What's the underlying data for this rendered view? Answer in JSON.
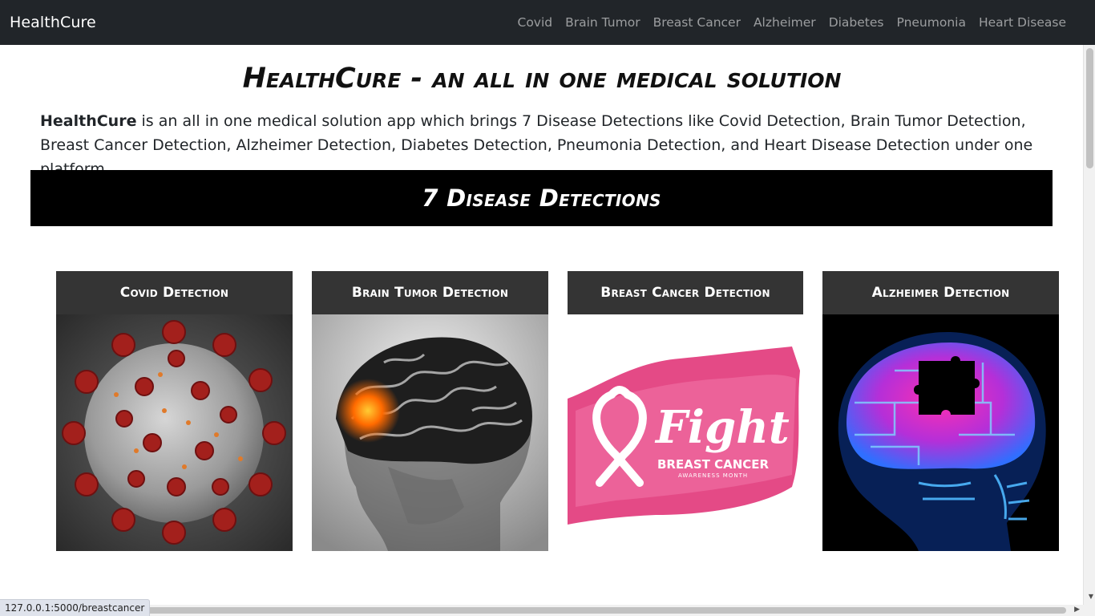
{
  "navbar": {
    "brand": "HealthCure",
    "links": [
      "Covid",
      "Brain Tumor",
      "Breast Cancer",
      "Alzheimer",
      "Diabetes",
      "Pneumonia",
      "Heart Disease"
    ]
  },
  "hero": {
    "title": "HealthCure - an all in one medical solution",
    "intro_brand": "HealthCure",
    "intro_text": " is an all in one medical solution app which brings 7 Disease Detections like Covid Detection, Brain Tumor Detection, Breast Cancer Detection, Alzheimer Detection, Diabetes Detection, Pneumonia Detection, and Heart Disease Detection under one platform."
  },
  "section": {
    "heading": "7 Disease Detections"
  },
  "cards": [
    {
      "title": "Covid Detection",
      "image": "coronavirus-illustration"
    },
    {
      "title": "Brain Tumor Detection",
      "image": "brain-xray-illustration"
    },
    {
      "title": "Breast Cancer Detection",
      "image": "pink-ribbon-fight-illustration",
      "image_text": "Fight",
      "image_subtext": "BREAST CANCER",
      "image_caption": "AWARENESS MONTH"
    },
    {
      "title": "Alzheimer Detection",
      "image": "brain-puzzle-xray-illustration"
    }
  ],
  "status_bar": {
    "url": "127.0.0.1:5000/breastcancer"
  },
  "colors": {
    "navbar_bg": "#212529",
    "banner_bg": "#000000",
    "card_header_bg": "#343434",
    "nav_link": "rgba(255,255,255,0.55)"
  }
}
